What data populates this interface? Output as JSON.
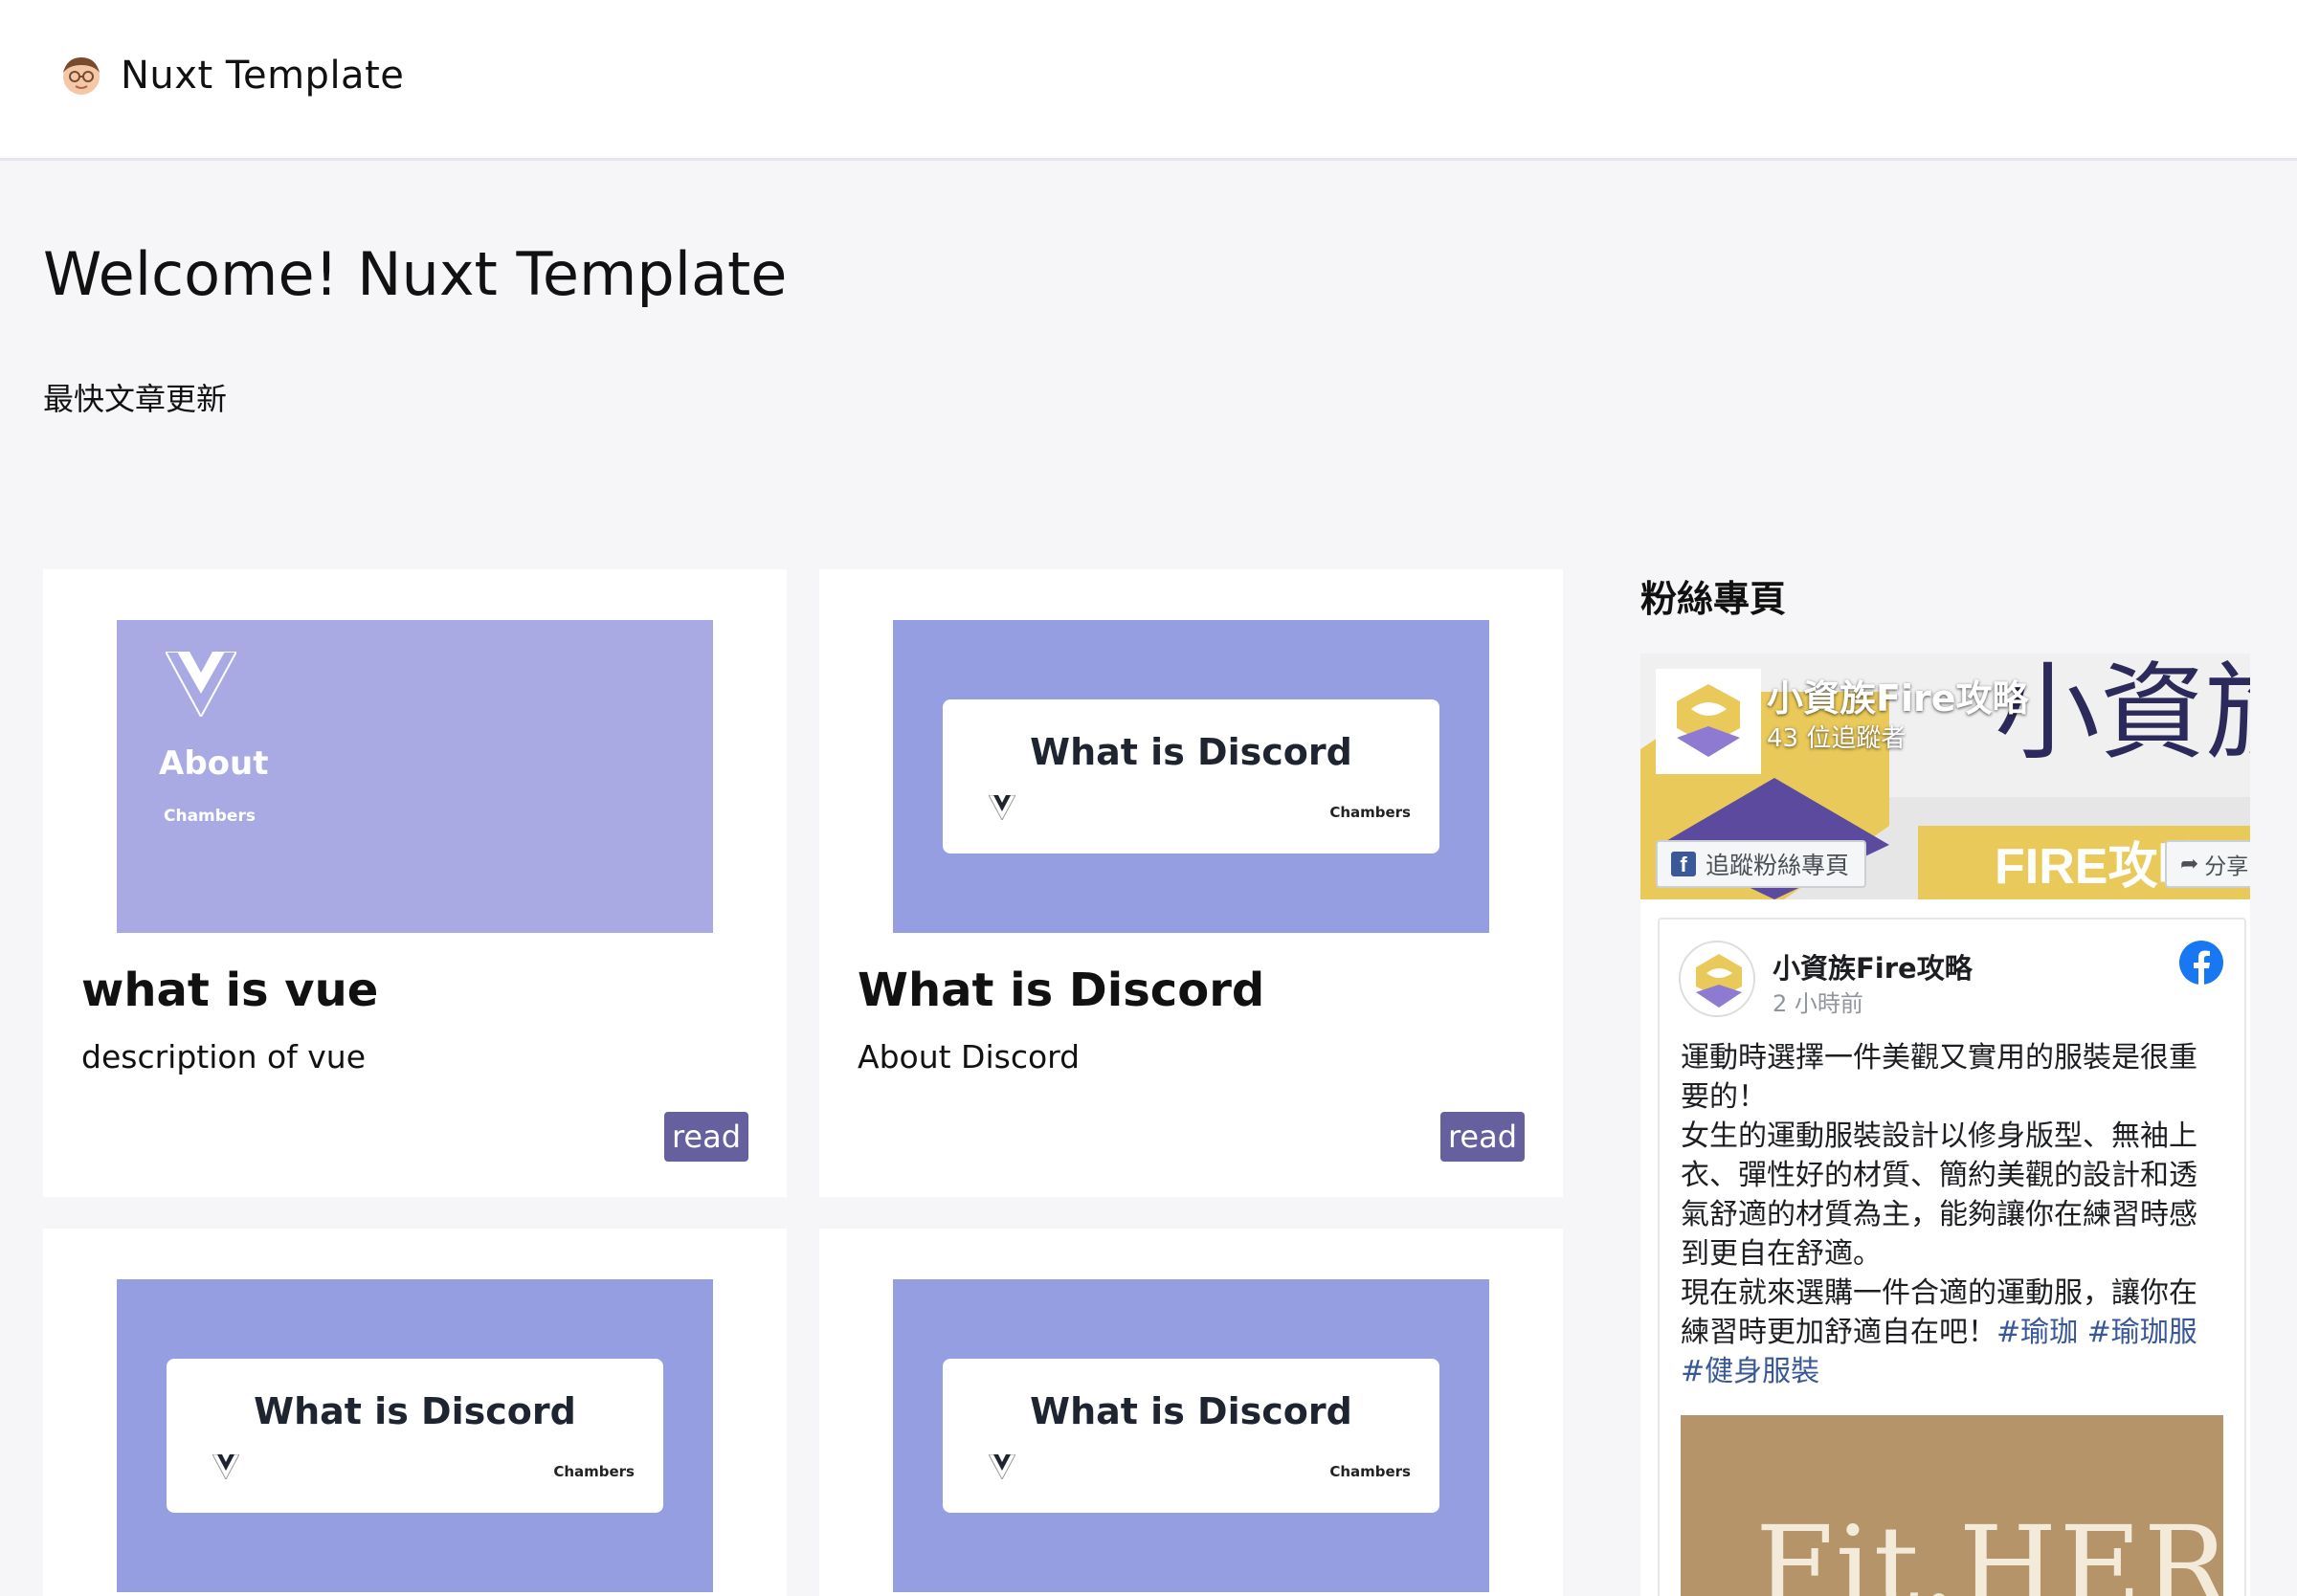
{
  "header": {
    "brand": "Nuxt Template"
  },
  "page": {
    "title": "Welcome! Nuxt Template",
    "section_label": "最快文章更新"
  },
  "articles": [
    {
      "thumbnail": {
        "style": "vue",
        "headline": "About",
        "brand": "Chambers",
        "background": "#a9aae4"
      },
      "title": "what is vue",
      "description": "description of vue",
      "read_label": "read"
    },
    {
      "thumbnail": {
        "style": "discord",
        "headline": "What is Discord",
        "brand": "Chambers",
        "background": "#949ee0"
      },
      "title": "What is Discord",
      "description": "About Discord",
      "read_label": "read"
    },
    {
      "thumbnail": {
        "style": "discord",
        "headline": "What is Discord",
        "brand": "Chambers",
        "background": "#949ee0"
      }
    },
    {
      "thumbnail": {
        "style": "discord",
        "headline": "What is Discord",
        "brand": "Chambers",
        "background": "#949ee0"
      }
    }
  ],
  "sidebar": {
    "heading": "粉絲專頁",
    "facebook": {
      "page_name": "小資族Fire攻略",
      "followers": "43 位追蹤者",
      "cover_calligraphy": "小資族",
      "cover_banner": "FIRE攻略",
      "follow_label": "追蹤粉絲專頁",
      "share_label": "分享",
      "post": {
        "author": "小資族Fire攻略",
        "time": "2 小時前",
        "text": "運動時選擇一件美觀又實用的服裝是很重要的！\n女生的運動服裝設計以修身版型、無袖上衣、彈性好的材質、簡約美觀的設計和透氣舒適的材質為主，能夠讓你在練習時感到更自在舒適。\n現在就來選購一件合適的運動服，讓你在練習時更加舒適自在吧！",
        "hashtags": "#瑜珈 #瑜珈服 #健身服裝",
        "image_text": "Fit.HER"
      }
    }
  },
  "colors": {
    "page_bg": "#f6f6f8",
    "read_button": "#67609f",
    "vue_thumb": "#a9aae4",
    "discord_thumb": "#949ee0",
    "facebook_blue": "#1877f2",
    "cover_yellow": "#e9c95a",
    "cover_purple": "#5b4a9e"
  }
}
